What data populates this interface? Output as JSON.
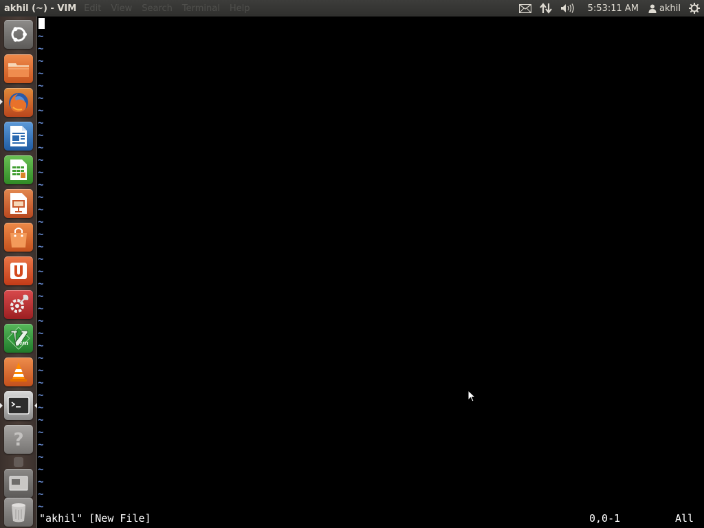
{
  "top_panel": {
    "window_title": "akhil (~) - VIM",
    "ghost_menu": [
      "Edit",
      "View",
      "Search",
      "Terminal",
      "Help"
    ],
    "indicators": {
      "mail_icon": "envelope-icon",
      "network_icon": "network-updown-icon",
      "sound_icon": "volume-icon",
      "clock": "5:53:11 AM",
      "user_icon": "user-icon",
      "user_name": "akhil",
      "session_icon": "power-gear-icon"
    }
  },
  "launcher": {
    "items": [
      {
        "name": "dash-home",
        "icon": "ubuntu-logo-icon",
        "color": "#7a7876"
      },
      {
        "name": "files",
        "icon": "folder-icon",
        "color": "#d9692a"
      },
      {
        "name": "firefox",
        "icon": "firefox-icon",
        "color": "#c9541f",
        "running": true
      },
      {
        "name": "libreoffice-writer",
        "icon": "writer-icon",
        "color": "#2a69b0"
      },
      {
        "name": "libreoffice-calc",
        "icon": "calc-icon",
        "color": "#3f9d2f"
      },
      {
        "name": "libreoffice-impress",
        "icon": "impress-icon",
        "color": "#c8562a"
      },
      {
        "name": "software-center",
        "icon": "shopping-bag-icon",
        "color": "#d9692a"
      },
      {
        "name": "ubuntu-one",
        "icon": "ubuntu-one-icon",
        "color": "#d34a1e"
      },
      {
        "name": "system-settings",
        "icon": "settings-wrench-icon",
        "color": "#b8282b"
      },
      {
        "name": "vim",
        "icon": "vim-icon",
        "color": "#2f9a3a"
      },
      {
        "name": "vlc",
        "icon": "vlc-cone-icon",
        "color": "#d9692a"
      },
      {
        "name": "terminal",
        "icon": "terminal-icon",
        "color": "#3b3b3b",
        "running": true,
        "focused": true
      },
      {
        "name": "help",
        "icon": "help-question-icon",
        "color": "#9a9896"
      },
      {
        "name": "workspace-switcher",
        "icon": "workspace-icon",
        "color": "#6e6c6a"
      },
      {
        "name": "trash",
        "icon": "trash-icon",
        "color": "#8a8886"
      }
    ]
  },
  "vim": {
    "tilde_char": "~",
    "status_message": "\"akhil\" [New File]",
    "cursor_position": "0,0-1",
    "scroll_position": "All",
    "colors": {
      "tilde": "#6a8fd8",
      "text": "#ffffff",
      "background": "#000000"
    }
  }
}
